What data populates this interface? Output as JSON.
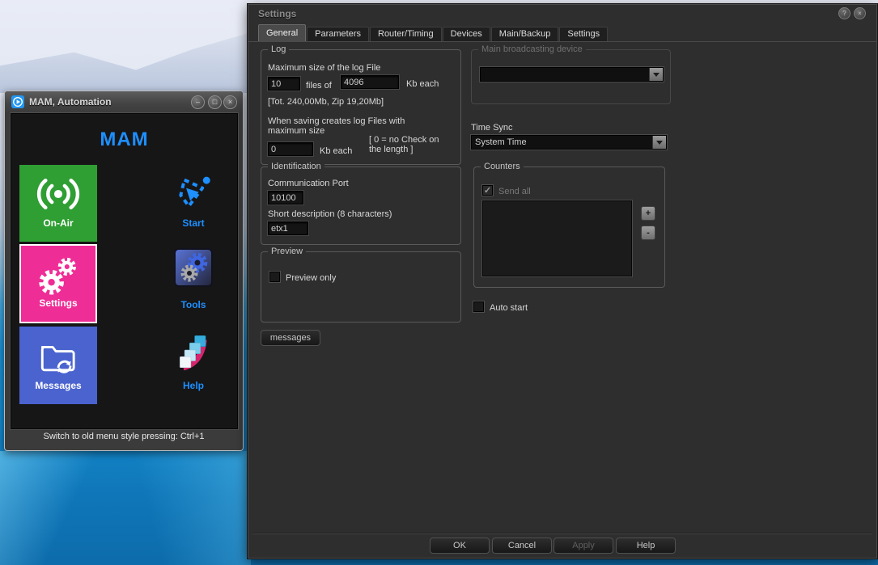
{
  "colors": {
    "accent_blue": "#1e8fff",
    "on_air_green": "#2f9e33",
    "settings_pink": "#ef2d96",
    "messages_blue": "#4a63cf",
    "desktop_blue": "#1287cd"
  },
  "mam_window": {
    "title": "MAM, Automation",
    "controls": {
      "minimize": "–",
      "maximize": "□",
      "close": "×"
    },
    "heading": "MAM",
    "tiles": [
      {
        "label": "On-Air",
        "color": "#2f9e33"
      },
      {
        "label": "Start"
      },
      {
        "label": "Settings",
        "color": "#ef2d96"
      },
      {
        "label": "Tools"
      },
      {
        "label": "Messages",
        "color": "#4a63cf"
      },
      {
        "label": "Help"
      }
    ],
    "status_text": "Switch to old menu style pressing: Ctrl+1"
  },
  "settings_dialog": {
    "title": "Settings",
    "help_glyph": "?",
    "close_glyph": "×",
    "tabs": [
      {
        "label": "General"
      },
      {
        "label": "Parameters"
      },
      {
        "label": "Router/Timing"
      },
      {
        "label": "Devices"
      },
      {
        "label": "Main/Backup"
      },
      {
        "label": "Settings"
      }
    ],
    "log_group": {
      "title": "Log",
      "max_size_label": "Maximum size of the log File",
      "files_value": "10",
      "files_of_label": "files of",
      "kb_value": "4096",
      "kb_each_label": "Kb each",
      "total_label": "[Tot. 240,00Mb, Zip 19,20Mb]",
      "when_saving_label": "When saving creates log Files with maximum size",
      "max_kb_value": "0",
      "kb_each_label2": "Kb each",
      "zero_note": "[ 0 = no Check on the length ]"
    },
    "identification_group": {
      "title": "Identification",
      "port_label": "Communication Port",
      "port_value": "10100",
      "desc_label": "Short description (8 characters)",
      "desc_value": "etx1"
    },
    "preview_group": {
      "title": "Preview",
      "checkbox_label": "Preview only",
      "checked": false
    },
    "messages_button_label": "messages",
    "broadcast_group": {
      "title": "Main broadcasting device",
      "dropdown_value": ""
    },
    "time_sync": {
      "label": "Time Sync",
      "value": "System Time"
    },
    "counters_group": {
      "title": "Counters",
      "send_all_label": "Send all",
      "send_all_checked": true,
      "check_glyph": "✓",
      "plus_label": "+",
      "minus_label": "-"
    },
    "auto_start_label": "Auto start",
    "footer_buttons": [
      {
        "label": "OK"
      },
      {
        "label": "Cancel"
      },
      {
        "label": "Apply",
        "disabled": true
      },
      {
        "label": "Help"
      }
    ]
  }
}
